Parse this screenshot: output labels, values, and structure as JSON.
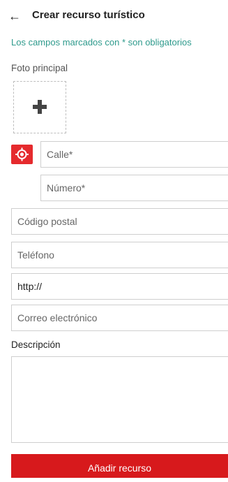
{
  "header": {
    "back_icon": "arrow-left-icon",
    "title": "Crear recurso turístico"
  },
  "form": {
    "required_notice": "Los campos marcados con * son obligatorios",
    "photo": {
      "label": "Foto principal",
      "add_icon": "plus-icon"
    },
    "location_button_icon": "location-target-icon",
    "street": {
      "placeholder": "Calle*",
      "value": ""
    },
    "number": {
      "placeholder": "Número*",
      "value": ""
    },
    "postal_code": {
      "placeholder": "Código postal",
      "value": ""
    },
    "phone": {
      "placeholder": "Teléfono",
      "value": ""
    },
    "website": {
      "placeholder": "",
      "value": "http://"
    },
    "email": {
      "placeholder": "Correo electrónico",
      "value": ""
    },
    "description": {
      "label": "Descripción",
      "value": ""
    },
    "submit_label": "Añadir recurso"
  },
  "colors": {
    "accent_red": "#d7191c",
    "notice_teal": "#2e9a8c",
    "border_gray": "#cfcfcf"
  }
}
